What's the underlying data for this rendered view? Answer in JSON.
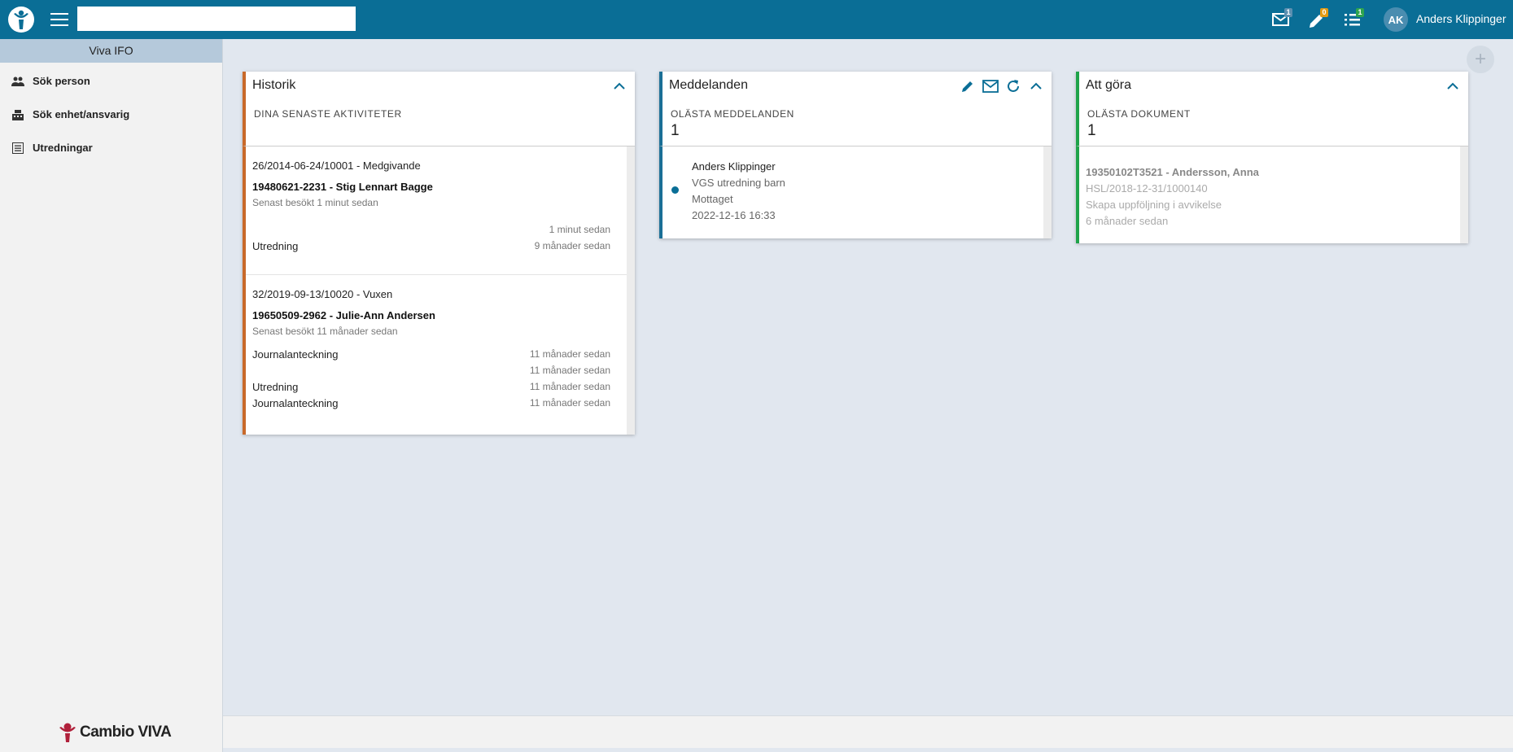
{
  "topbar": {
    "search_value": "",
    "icons": [
      {
        "name": "mail-icon",
        "badge": "1",
        "badge_color": "#5b8fb0"
      },
      {
        "name": "pencil-icon",
        "badge": "0",
        "badge_color": "#e39a12"
      },
      {
        "name": "checklist-icon",
        "badge": "1",
        "badge_color": "#2ea44f"
      }
    ],
    "avatar_initials": "AK",
    "user_name": "Anders Klippinger"
  },
  "sidebar": {
    "header": "Viva IFO",
    "items": [
      {
        "label": "Sök person",
        "icon": "people-icon"
      },
      {
        "label": "Sök enhet/ansvarig",
        "icon": "building-icon"
      },
      {
        "label": "Utredningar",
        "icon": "list-icon"
      }
    ],
    "brand": "Cambio VIVA"
  },
  "cards": {
    "history": {
      "title": "Historik",
      "subtitle": "DINA SENASTE AKTIVITETER",
      "accent": "#c8692a",
      "entries": [
        {
          "case": "26/2014-06-24/10001 - Medgivande",
          "person": "19480621-2231 - Stig Lennart Bagge",
          "visited": "Senast besökt 1 minut sedan",
          "rows": [
            {
              "label": "",
              "time": "1 minut sedan"
            },
            {
              "label": "Utredning",
              "time": "9 månader sedan"
            }
          ]
        },
        {
          "case": "32/2019-09-13/10020 - Vuxen",
          "person": "19650509-2962 - Julie-Ann Andersen",
          "visited": "Senast besökt 11 månader sedan",
          "rows": [
            {
              "label": "Journalanteckning",
              "time": "11 månader sedan"
            },
            {
              "label": "",
              "time": "11 månader sedan"
            },
            {
              "label": "Utredning",
              "time": "11 månader sedan"
            },
            {
              "label": "Journalanteckning",
              "time": "11 månader sedan"
            }
          ]
        }
      ]
    },
    "messages": {
      "title": "Meddelanden",
      "subtitle": "OLÄSTA MEDDELANDEN",
      "count": "1",
      "accent": "#1a6f96",
      "entry": {
        "from": "Anders Klippinger",
        "subject": "VGS utredning barn",
        "status": "Mottaget",
        "date": "2022-12-16 16:33"
      }
    },
    "todo": {
      "title": "Att göra",
      "subtitle": "OLÄSTA DOKUMENT",
      "count": "1",
      "accent": "#1fa34a",
      "entry": {
        "title": "19350102T3521 - Andersson, Anna",
        "ref": "HSL/2018-12-31/1000140",
        "action": "Skapa uppföljning i avvikelse",
        "time": "6 månader sedan"
      }
    }
  },
  "add_widget_label": "+"
}
